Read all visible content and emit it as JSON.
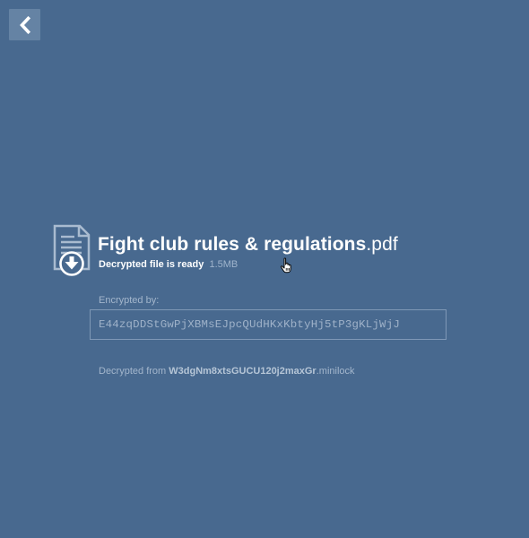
{
  "header": {
    "back_icon": "chevron-left-icon"
  },
  "file": {
    "icon": "document-download-icon",
    "name_base": "Fight club rules & regulations",
    "name_ext": ".pdf",
    "status": "Decrypted file is ready",
    "size": "1.5MB"
  },
  "encrypted": {
    "label": "Encrypted by:",
    "value": "E44zqDDStGwPjXBMsEJpcQUdHKxKbtyHj5tP3gKLjWjJ"
  },
  "decrypted_from": {
    "prefix": "Decrypted from",
    "source_name": "W3dgNm8xtsGUCU120j2maxGr",
    "source_ext": ".minilock"
  },
  "colors": {
    "background": "#48698f",
    "button_bg": "#6583a4",
    "muted_text": "#a3b6cc"
  }
}
